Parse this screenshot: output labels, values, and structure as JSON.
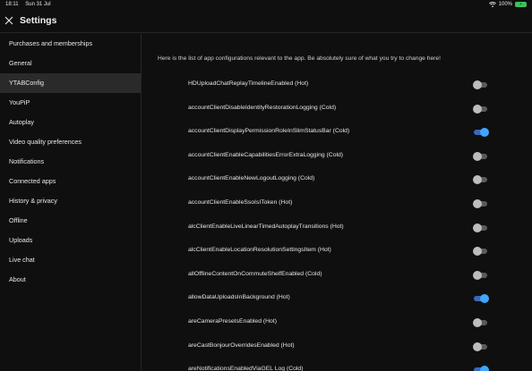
{
  "status_bar": {
    "time": "18:11",
    "date": "Sun 31 Jul",
    "battery_percent": "100%",
    "battery_icon": "battery-charging-icon",
    "wifi_icon": "wifi-icon"
  },
  "header": {
    "title": "Settings",
    "close_icon": "close-icon"
  },
  "sidebar": {
    "items": [
      {
        "label": "Purchases and memberships",
        "active": false
      },
      {
        "label": "General",
        "active": false
      },
      {
        "label": "YTABConfig",
        "active": true
      },
      {
        "label": "YouPiP",
        "active": false
      },
      {
        "label": "Autoplay",
        "active": false
      },
      {
        "label": "Video quality preferences",
        "active": false
      },
      {
        "label": "Notifications",
        "active": false
      },
      {
        "label": "Connected apps",
        "active": false
      },
      {
        "label": "History & privacy",
        "active": false
      },
      {
        "label": "Offline",
        "active": false
      },
      {
        "label": "Uploads",
        "active": false
      },
      {
        "label": "Live chat",
        "active": false
      },
      {
        "label": "About",
        "active": false
      }
    ]
  },
  "main": {
    "notice": "Here is the list of app configurations relevant to the app. Be absolutely sure of what you try to change here!",
    "settings": [
      {
        "label": "HDUploadChatReplayTimelineEnabled (Hot)",
        "on": false
      },
      {
        "label": "accountClientDisableIdentityRestorationLogging (Cold)",
        "on": false
      },
      {
        "label": "accountClientDisplayPermissionRoleInSlimStatusBar (Cold)",
        "on": true
      },
      {
        "label": "accountClientEnableCapabilitiesErrorExtraLogging (Cold)",
        "on": false
      },
      {
        "label": "accountClientEnableNewLogoutLogging (Cold)",
        "on": false
      },
      {
        "label": "accountClientEnableSsoIsIToken (Hot)",
        "on": false
      },
      {
        "label": "alcClientEnableLiveLinearTimedAutoplayTransitions (Hot)",
        "on": false
      },
      {
        "label": "alcClientEnableLocationResolutionSettingsItem (Hot)",
        "on": false
      },
      {
        "label": "allOfflineContentOnCommuteShelfEnabled (Cold)",
        "on": false
      },
      {
        "label": "allowDataUploadsInBackground (Hot)",
        "on": true
      },
      {
        "label": "areCameraPresetsEnabled (Hot)",
        "on": false
      },
      {
        "label": "areCastBonjourOverridesEnabled (Hot)",
        "on": false
      },
      {
        "label": "areNotificationsEnabledViaGEL Log (Cold)",
        "on": true
      }
    ]
  }
}
